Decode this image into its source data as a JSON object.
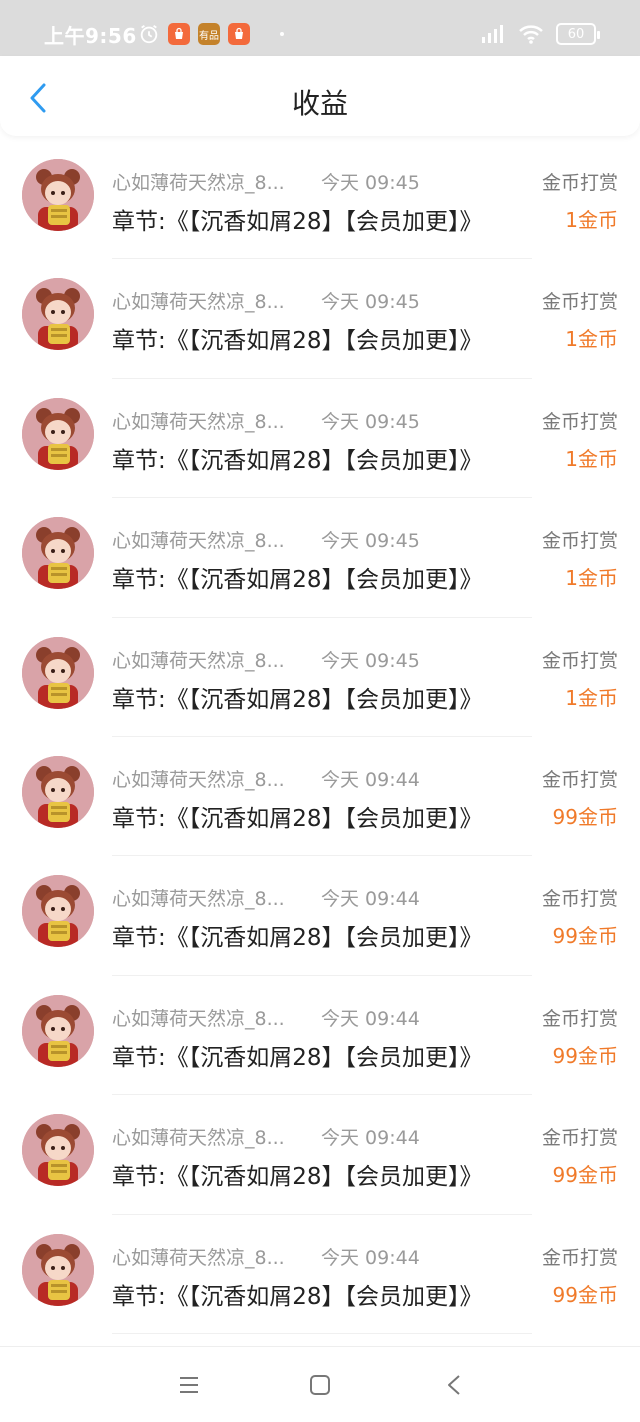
{
  "status_bar": {
    "time": "上午9:56",
    "battery": "60",
    "badge_app_2": "有品"
  },
  "header": {
    "title": "收益"
  },
  "colors": {
    "amount": "#f07a2a",
    "accent": "#2f9bf0"
  },
  "icons": {
    "back": "chevron-left-icon",
    "menu": "menu-icon",
    "home": "square-icon",
    "nav_back": "triangle-back-icon"
  },
  "items": [
    {
      "name": "心如薄荷天然凉_8...",
      "time": "今天 09:45",
      "type": "金币打赏",
      "chapter": "章节:《【沉香如屑28】【会员加更】》",
      "amount": "1金币"
    },
    {
      "name": "心如薄荷天然凉_8...",
      "time": "今天 09:45",
      "type": "金币打赏",
      "chapter": "章节:《【沉香如屑28】【会员加更】》",
      "amount": "1金币"
    },
    {
      "name": "心如薄荷天然凉_8...",
      "time": "今天 09:45",
      "type": "金币打赏",
      "chapter": "章节:《【沉香如屑28】【会员加更】》",
      "amount": "1金币"
    },
    {
      "name": "心如薄荷天然凉_8...",
      "time": "今天 09:45",
      "type": "金币打赏",
      "chapter": "章节:《【沉香如屑28】【会员加更】》",
      "amount": "1金币"
    },
    {
      "name": "心如薄荷天然凉_8...",
      "time": "今天 09:45",
      "type": "金币打赏",
      "chapter": "章节:《【沉香如屑28】【会员加更】》",
      "amount": "1金币"
    },
    {
      "name": "心如薄荷天然凉_8...",
      "time": "今天 09:44",
      "type": "金币打赏",
      "chapter": "章节:《【沉香如屑28】【会员加更】》",
      "amount": "99金币"
    },
    {
      "name": "心如薄荷天然凉_8...",
      "time": "今天 09:44",
      "type": "金币打赏",
      "chapter": "章节:《【沉香如屑28】【会员加更】》",
      "amount": "99金币"
    },
    {
      "name": "心如薄荷天然凉_8...",
      "time": "今天 09:44",
      "type": "金币打赏",
      "chapter": "章节:《【沉香如屑28】【会员加更】》",
      "amount": "99金币"
    },
    {
      "name": "心如薄荷天然凉_8...",
      "time": "今天 09:44",
      "type": "金币打赏",
      "chapter": "章节:《【沉香如屑28】【会员加更】》",
      "amount": "99金币"
    },
    {
      "name": "心如薄荷天然凉_8...",
      "time": "今天 09:44",
      "type": "金币打赏",
      "chapter": "章节:《【沉香如屑28】【会员加更】》",
      "amount": "99金币"
    }
  ]
}
